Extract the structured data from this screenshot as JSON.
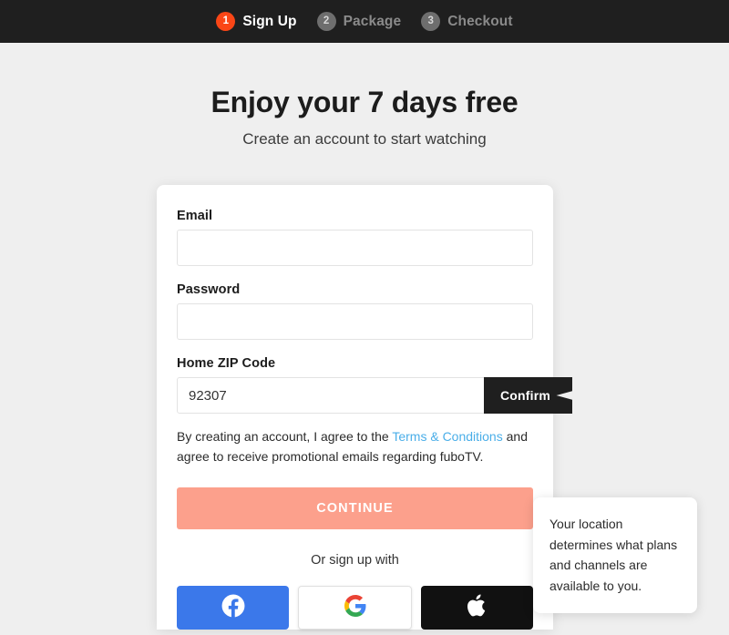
{
  "stepper": {
    "steps": [
      {
        "number": "1",
        "label": "Sign Up",
        "state": "active"
      },
      {
        "number": "2",
        "label": "Package",
        "state": "inactive"
      },
      {
        "number": "3",
        "label": "Checkout",
        "state": "inactive"
      }
    ],
    "bar_color": "#1f1f1f",
    "active_color": "#fa4616",
    "inactive_circle_color": "#6e6e6e"
  },
  "heading": {
    "title": "Enjoy your 7 days free",
    "subtitle": "Create an account to start watching"
  },
  "form": {
    "email": {
      "label": "Email",
      "value": "",
      "placeholder": ""
    },
    "password": {
      "label": "Password",
      "value": "",
      "placeholder": ""
    },
    "zip": {
      "label": "Home ZIP Code",
      "value": "92307",
      "placeholder": ""
    },
    "confirm_button": "Confirm"
  },
  "tooltip": {
    "text": "Your location determines what plans and channels are available to you."
  },
  "terms": {
    "prefix": "By creating an account, I agree to the ",
    "link": "Terms & Conditions",
    "suffix": " and agree to receive promotional emails regarding fuboTV.",
    "link_color": "#4aaee8"
  },
  "actions": {
    "continue_label": "CONTINUE",
    "continue_color": "#fca08c",
    "or_label": "Or sign up with"
  },
  "social": [
    {
      "name": "facebook",
      "icon": "facebook-icon",
      "color": "#3b78ea"
    },
    {
      "name": "google",
      "icon": "google-icon",
      "color": "#ffffff"
    },
    {
      "name": "apple",
      "icon": "apple-icon",
      "color": "#111111"
    }
  ],
  "page": {
    "background": "#efefef",
    "card_background": "#ffffff"
  }
}
